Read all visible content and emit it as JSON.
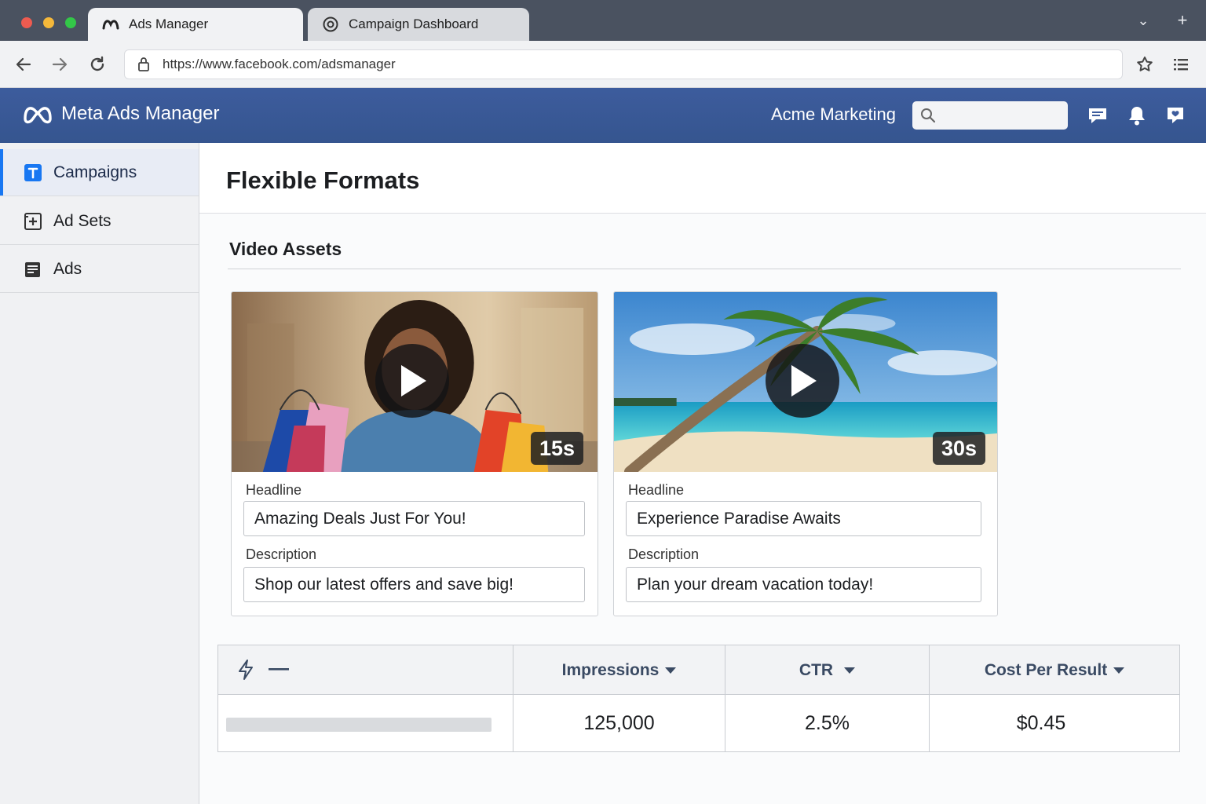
{
  "browser": {
    "tabs": [
      {
        "label": "Ads Manager",
        "icon": "meta-tab-icon",
        "active": true
      },
      {
        "label": "Campaign Dashboard",
        "icon": "dashboard-tab-icon",
        "active": false
      }
    ],
    "url": "https://www.facebook.com/adsmanager"
  },
  "app": {
    "brand": "Meta Ads Manager",
    "account": "Acme Marketing",
    "search_placeholder": "",
    "accent": "#3b5998"
  },
  "sidebar": {
    "items": [
      {
        "label": "Campaigns",
        "icon": "campaign-icon",
        "active": true
      },
      {
        "label": "Ad Sets",
        "icon": "ad-set-icon",
        "active": false
      },
      {
        "label": "Ads",
        "icon": "ads-icon",
        "active": false
      }
    ]
  },
  "page": {
    "title": "Flexible Formats",
    "section_title": "Video Assets"
  },
  "videos": [
    {
      "duration": "15s",
      "headline_label": "Headline",
      "headline": "Amazing Deals Just For You!",
      "description_label": "Description",
      "description": "Shop our latest offers and save big!"
    },
    {
      "duration": "30s",
      "headline_label": "Headline",
      "headline": "Experience Paradise Awaits",
      "description_label": "Description",
      "description": "Plan your dream vacation today!"
    }
  ],
  "metrics": {
    "columns": [
      "Impressions",
      "CTR",
      "Cost Per Result"
    ],
    "values": [
      "125,000",
      "2.5%",
      "$0.45"
    ]
  }
}
